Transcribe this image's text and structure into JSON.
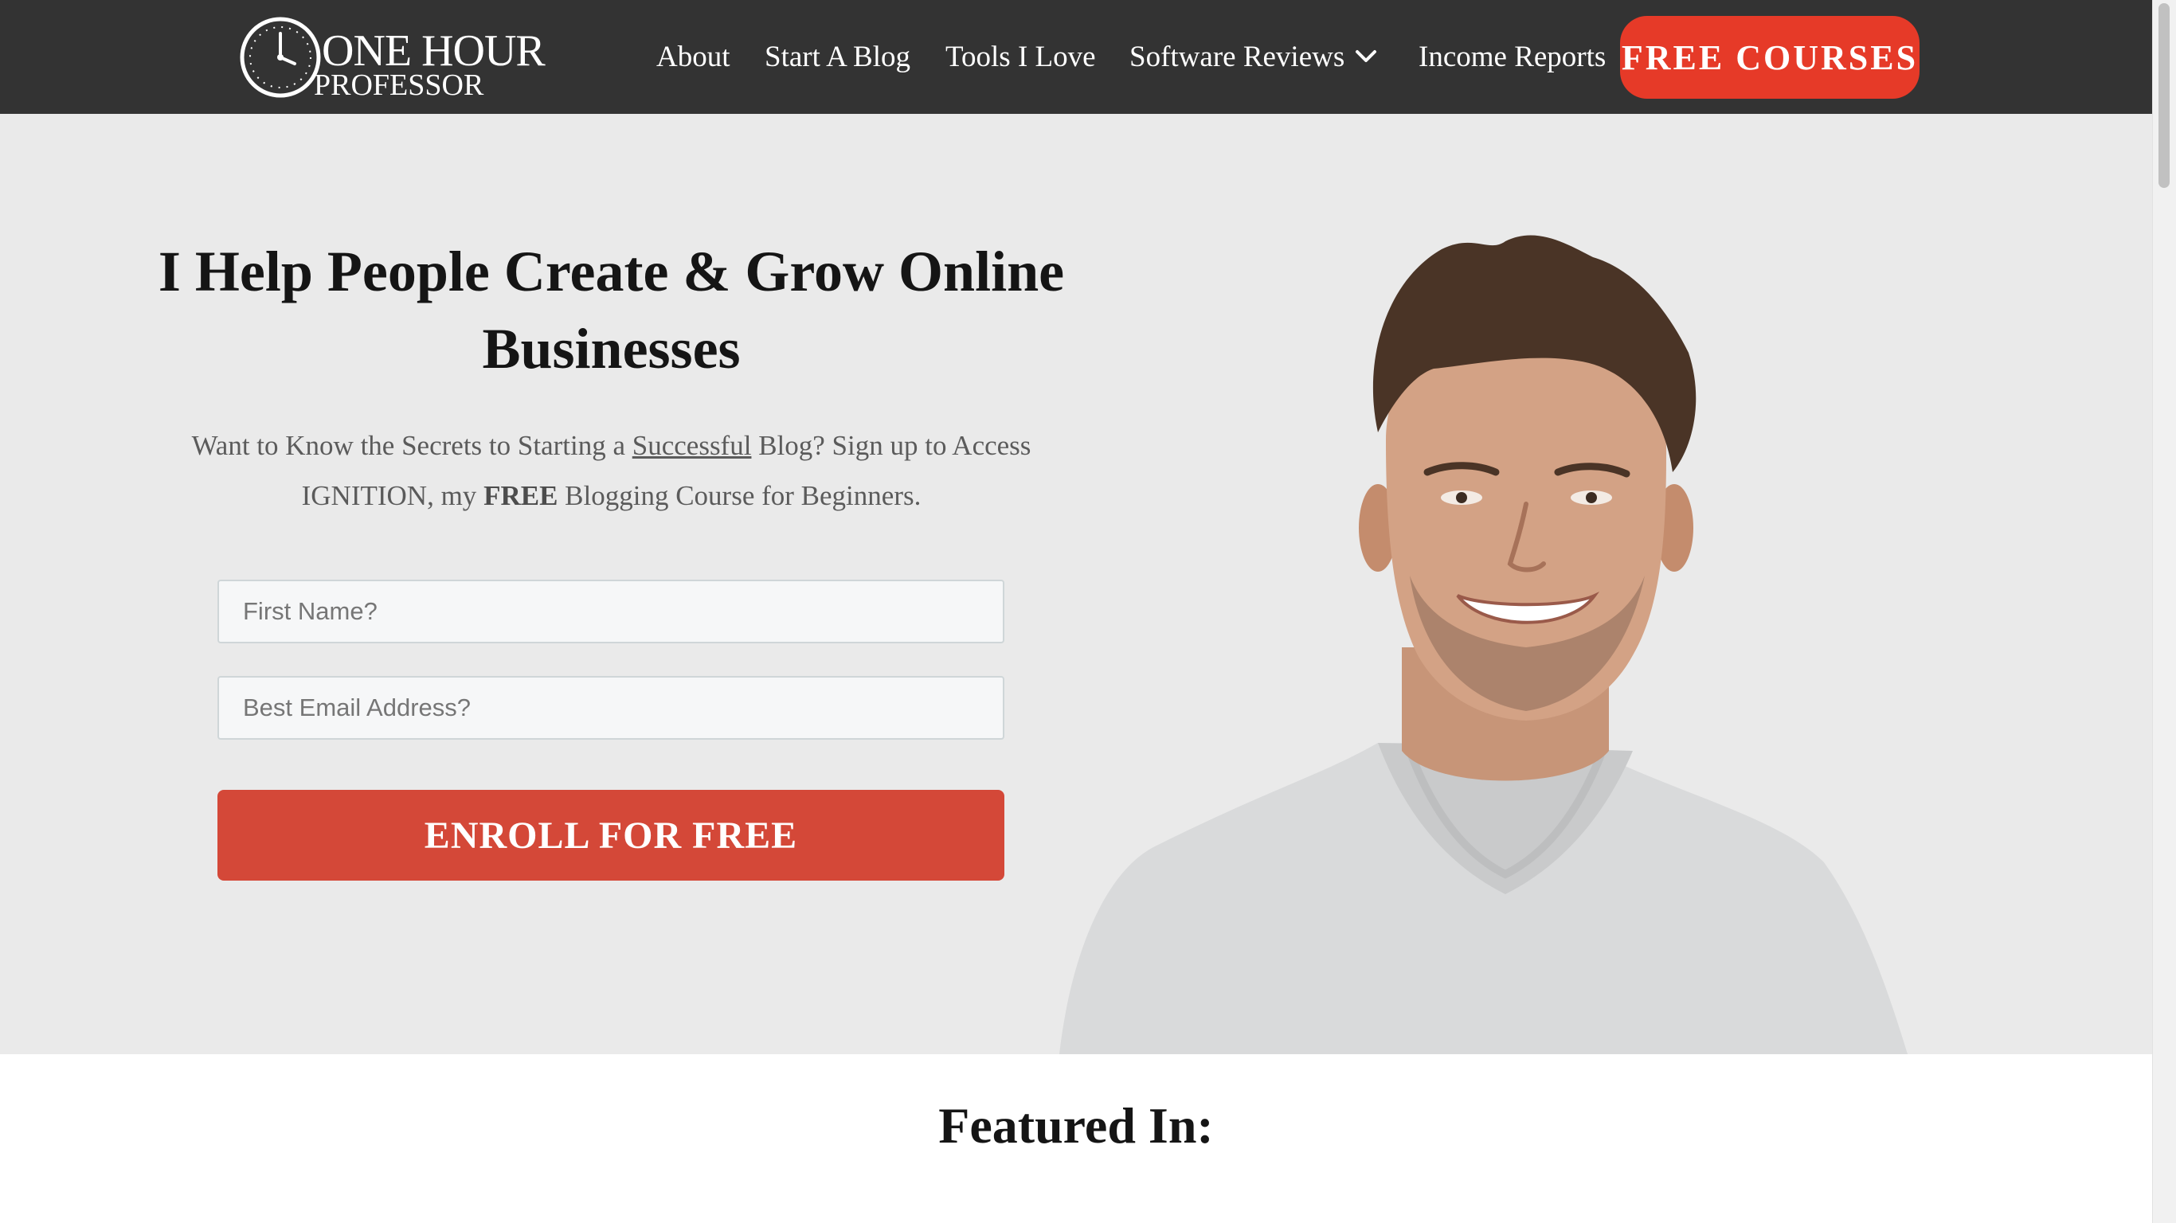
{
  "nav": {
    "logo_line1": "ONE HOUR",
    "logo_line2": "PROFESSOR",
    "items": [
      {
        "label": "About"
      },
      {
        "label": "Start A Blog"
      },
      {
        "label": "Tools I Love"
      },
      {
        "label": "Software Reviews"
      },
      {
        "label": "Income Reports"
      }
    ],
    "cta_label": "FREE COURSES"
  },
  "hero": {
    "title": "I Help People Create & Grow Online Businesses",
    "sub_part1": "Want to Know the Secrets to Starting a ",
    "sub_link": "Successful",
    "sub_part2": " Blog?  Sign up to Access IGNITION, my ",
    "sub_bold": "FREE",
    "sub_part3": " Blogging Course for Beginners.",
    "first_name_placeholder": "First Name?",
    "email_placeholder": "Best Email Address?",
    "enroll_label": "ENROLL FOR FREE"
  },
  "featured": {
    "title": "Featured In:"
  },
  "colors": {
    "nav_bg": "#333333",
    "cta": "#e63a28",
    "enroll": "#d44838",
    "hero_bg": "#eaeaea"
  },
  "icons": {
    "logo": "clock-logo-icon",
    "dropdown": "chevron-down-icon"
  }
}
